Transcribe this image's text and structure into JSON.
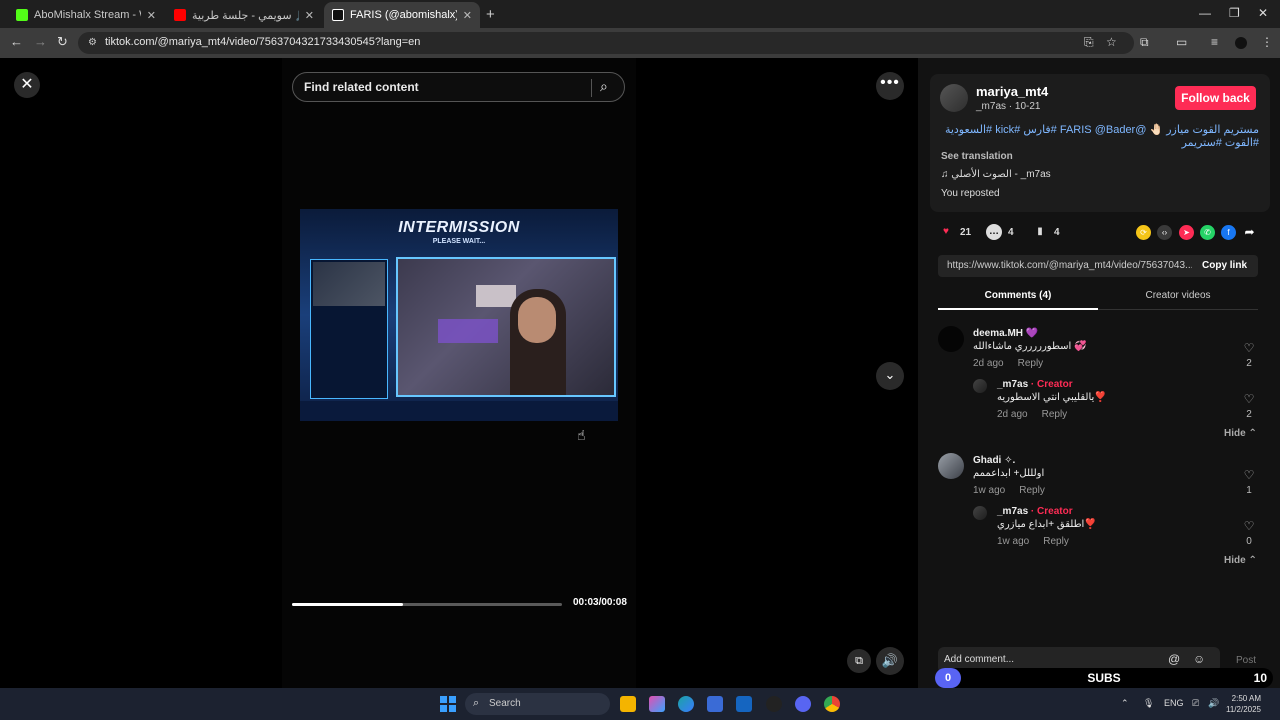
{
  "browser": {
    "tabs": [
      {
        "title": "AboMishalx Stream - Watch Liv",
        "favicon_color": "#53fc18",
        "active": false
      },
      {
        "title": "سويمي - جلسة طربية 🎵 🎶 🎼 🎵",
        "favicon_color": "#ff0000",
        "active": false
      },
      {
        "title": "FARIS (@abomishalx) | TikTo",
        "favicon_color": "#ffffff",
        "active": true
      }
    ],
    "new_tab": "+",
    "url": "tiktok.com/@mariya_mt4/video/7563704321733430545?lang=en"
  },
  "player": {
    "search_placeholder": "Find related content",
    "video_frame": {
      "title": "INTERMISSION",
      "subtitle": "PLEASE WAIT..."
    },
    "progress": 0.41,
    "time": "00:03/00:08"
  },
  "post": {
    "username": "mariya_mt4",
    "nickname_date": "_m7as · 10-21",
    "follow_label": "Follow back",
    "description": "مستريم القوت ميازر 🤚🏻 @FARIS @Bader #فارس #kick #السعودية #القوت #ستريمر",
    "see_translation": "See translation",
    "music": "♫  الصوت الأصلي - _m7as",
    "repost": "You reposted",
    "likes": "21",
    "comments": "4",
    "saves": "4",
    "link": "https://www.tiktok.com/@mariya_mt4/video/75637043...",
    "copy_link": "Copy link",
    "tab_comments": "Comments (4)",
    "tab_creator": "Creator videos"
  },
  "comments": [
    {
      "user": "deema.MH 💜",
      "text": "اسطوررررري ماشاءالله 💞",
      "time": "2d ago",
      "reply": "Reply",
      "likes": "2"
    },
    {
      "user": "_m7as",
      "creator": " · Creator",
      "text": "يالقليبي انتي الاسطوريه❣️",
      "time": "2d ago",
      "reply": "Reply",
      "likes": "2"
    },
    {
      "user": "Ghadi ✧.",
      "text": "اولللل+ ابداعممم",
      "time": "1w ago",
      "reply": "Reply",
      "likes": "1"
    },
    {
      "user": "_m7as",
      "creator": " · Creator",
      "text": "اطلقق +ابداع ميازري❣️",
      "time": "1w ago",
      "reply": "Reply",
      "likes": "0"
    }
  ],
  "hide_label": "Hide ⌃",
  "add_comment": {
    "placeholder": "Add comment...",
    "post": "Post"
  },
  "subs": {
    "left": "0",
    "label": "SUBS",
    "right": "10"
  },
  "taskbar": {
    "search": "Search",
    "lang": "ENG",
    "time": "2:50 AM",
    "date": "11/2/2025"
  }
}
